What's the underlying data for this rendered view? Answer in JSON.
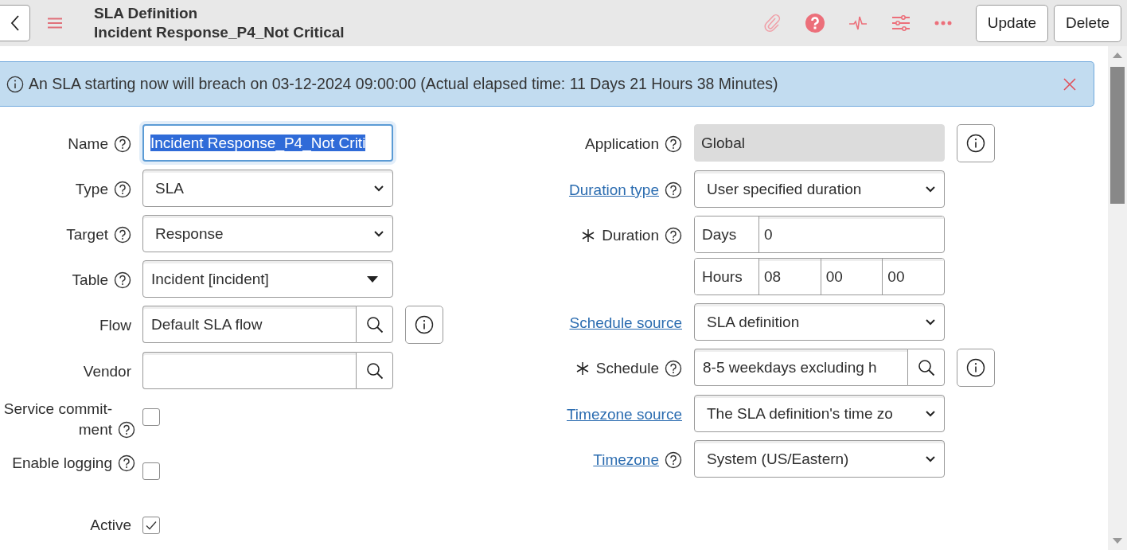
{
  "header": {
    "title": "SLA Definition",
    "subtitle": "Incident Response_P4_Not Critical",
    "buttons": [
      "Update",
      "Delete"
    ]
  },
  "banner": {
    "message": "An SLA starting now will breach on 03-12-2024 09:00:00 (Actual elapsed time: 11 Days 21 Hours 38 Minutes)"
  },
  "left_fields": [
    {
      "label": {
        "text": "Name",
        "help": true
      },
      "kind": "text",
      "value": "Incident Response_P4_Not Criti",
      "selected": true
    },
    {
      "label": {
        "text": "Type",
        "help": true
      },
      "kind": "select",
      "value": "SLA"
    },
    {
      "label": {
        "text": "Target",
        "help": true
      },
      "kind": "select",
      "value": "Response"
    },
    {
      "label": {
        "text": "Table",
        "help": true
      },
      "kind": "choice",
      "value": "Incident [incident]"
    },
    {
      "label": {
        "text": "Flow",
        "help": false
      },
      "kind": "reference",
      "value": "Default SLA flow",
      "info": true
    },
    {
      "label": {
        "text": "Vendor",
        "help": false
      },
      "kind": "reference",
      "info": false
    },
    {
      "label": {
        "text": "Service commit-ment",
        "help": true
      },
      "kind": "checkbox",
      "checked": false
    },
    {
      "label": {
        "text": "Enable logging",
        "help": true
      },
      "kind": "checkbox",
      "checked": false
    },
    {
      "label": {
        "text": "Active",
        "help": false
      },
      "kind": "checkbox",
      "checked": true
    }
  ],
  "right_fields": [
    {
      "label": {
        "text": "Application",
        "help": true,
        "link": false,
        "required": false
      },
      "kind": "readonly",
      "value": "Global",
      "info": true
    },
    {
      "label": {
        "text": "Duration type",
        "help": true,
        "link": true,
        "required": false
      },
      "kind": "select",
      "value": "User specified duration"
    },
    {
      "label": {
        "text": "Duration",
        "help": true,
        "link": false,
        "required": true
      },
      "kind": "duration",
      "days_label": "Days",
      "days": "0",
      "hours_label": "Hours",
      "hours": "08",
      "minutes": "00",
      "seconds": "00"
    },
    {
      "label": {
        "text": "Schedule source",
        "help": false,
        "link": true,
        "required": false
      },
      "kind": "select",
      "value": "SLA definition"
    },
    {
      "label": {
        "text": "Schedule",
        "help": true,
        "link": false,
        "required": true
      },
      "kind": "reference",
      "value": "8-5 weekdays excluding h",
      "info": true
    },
    {
      "label": {
        "text": "Timezone source",
        "help": false,
        "link": true,
        "required": false
      },
      "kind": "select",
      "value": "The SLA definition's time zo"
    },
    {
      "label": {
        "text": "Timezone",
        "help": true,
        "link": true,
        "required": false
      },
      "kind": "select",
      "value": "System (US/Eastern)"
    }
  ]
}
